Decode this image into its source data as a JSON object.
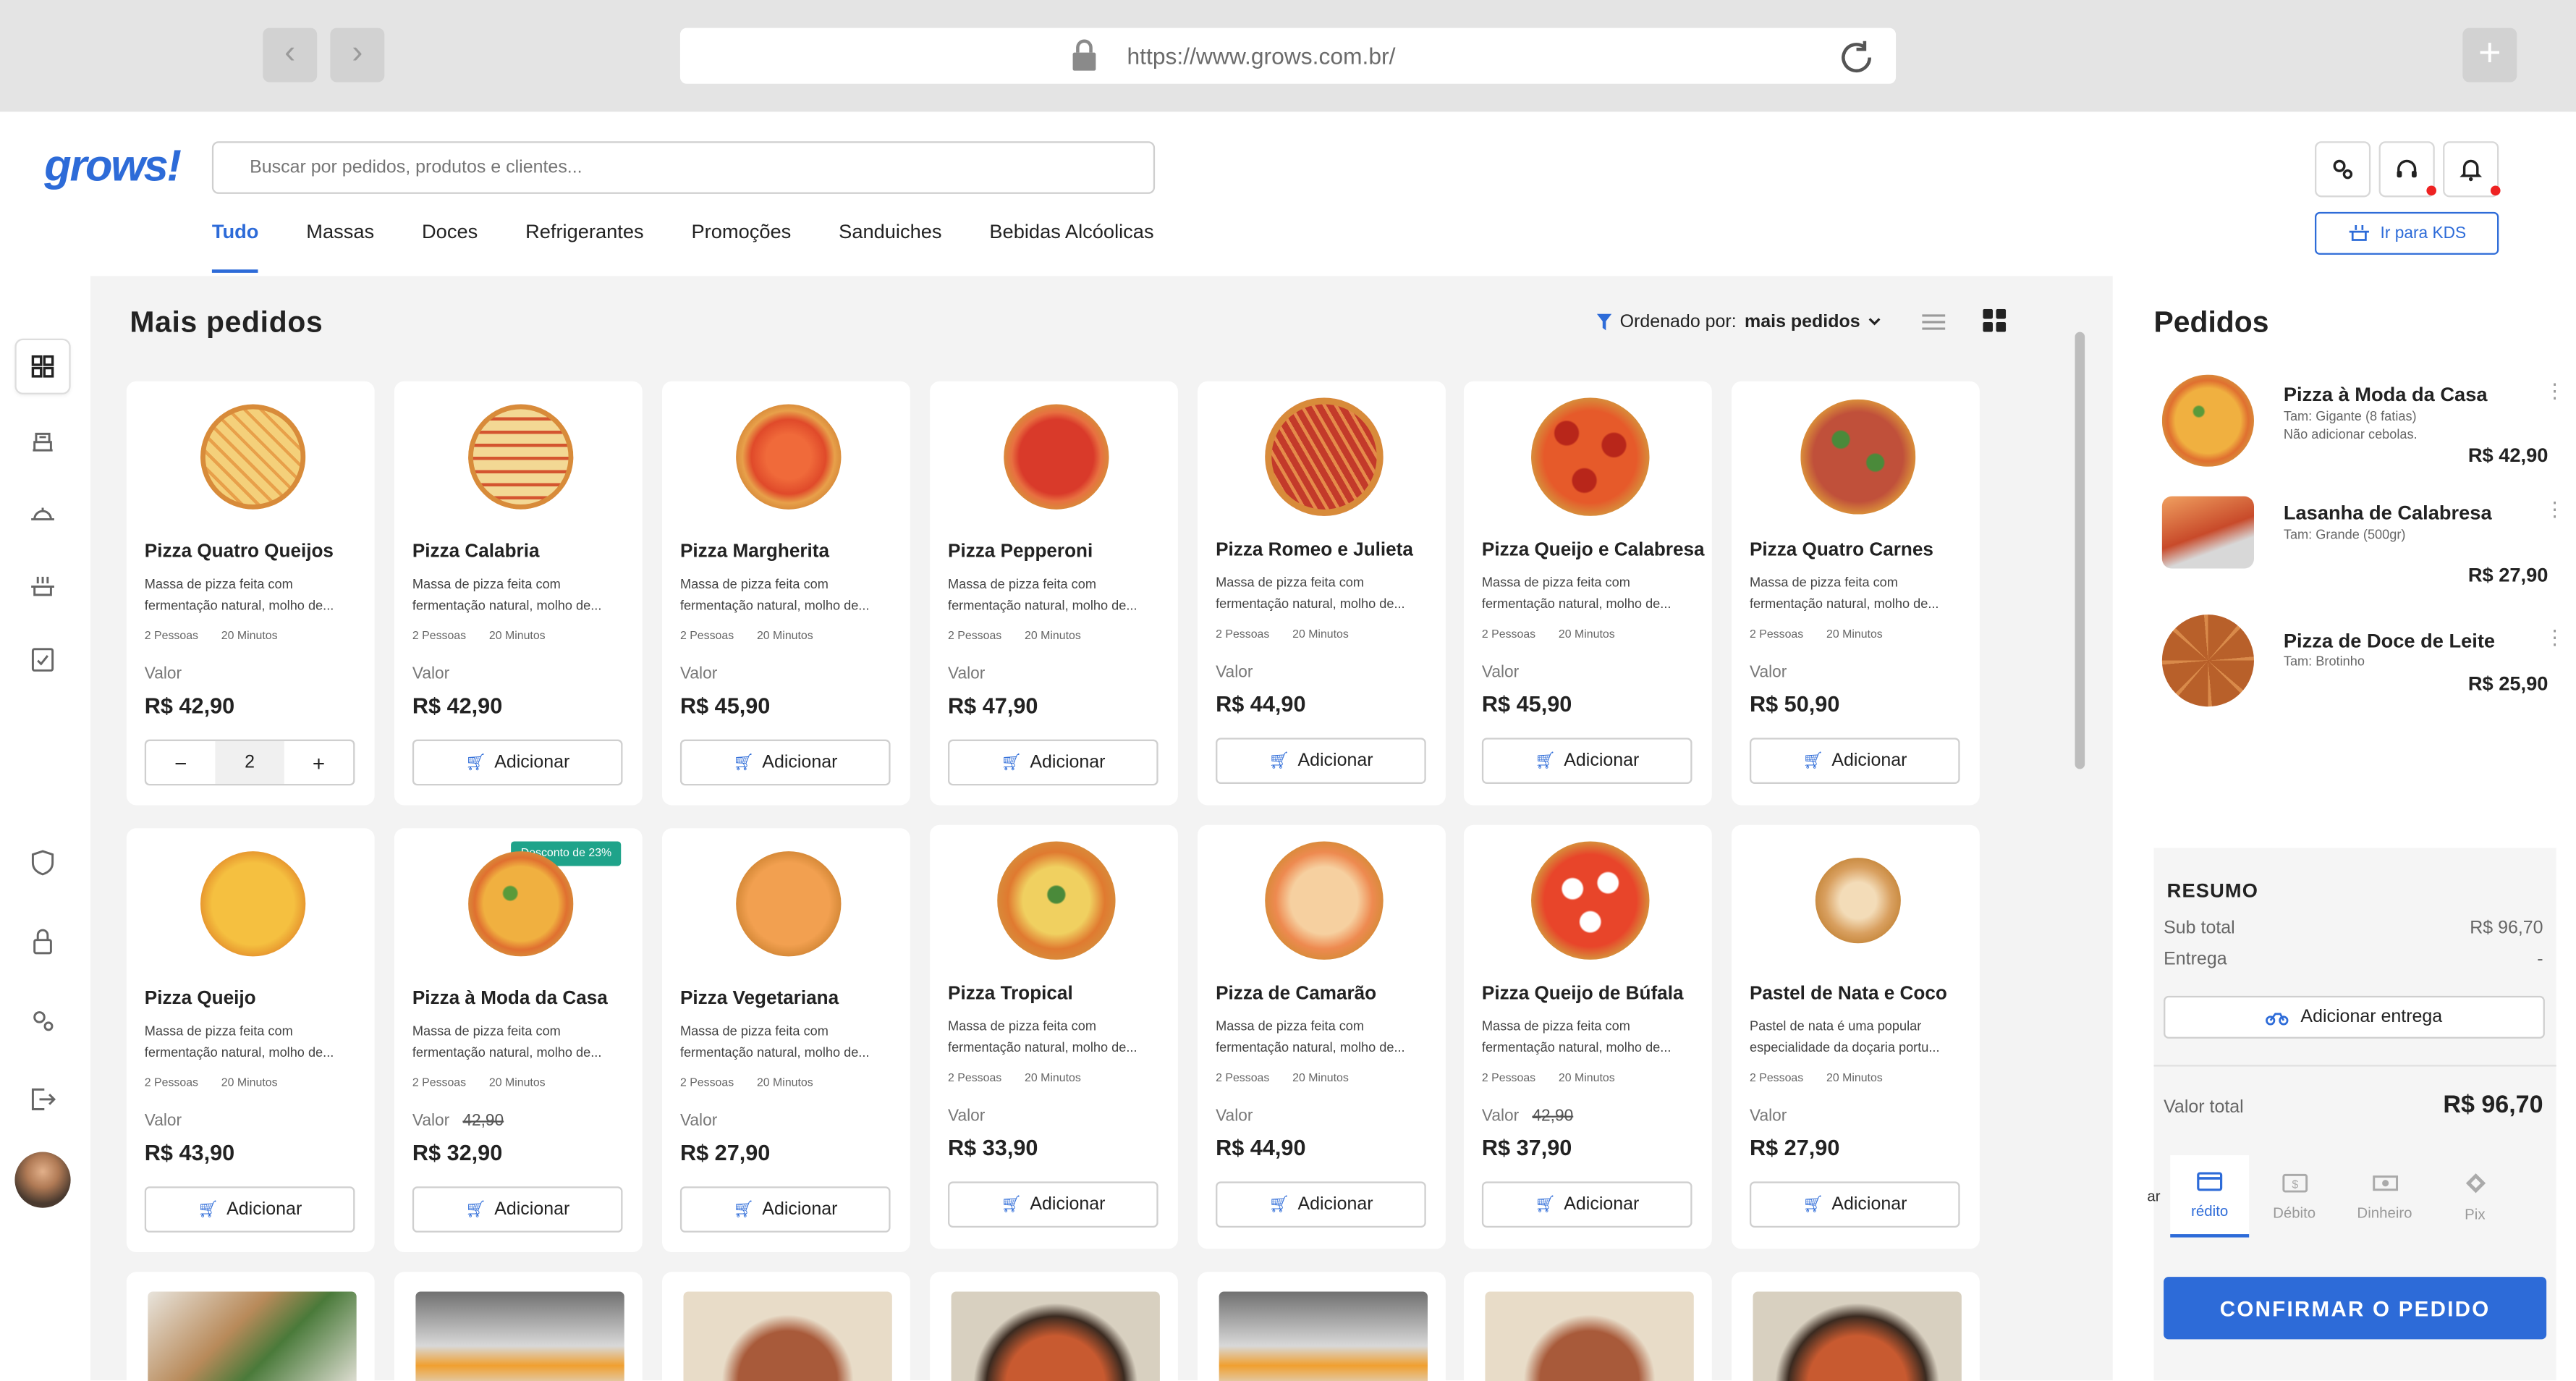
{
  "browser": {
    "url": "https://www.grows.com.br/",
    "back": "‹",
    "forward": "›",
    "new_tab": "+"
  },
  "app": {
    "logo": "grows!",
    "search_placeholder": "Buscar por pedidos, produtos e clientes...",
    "kds_label": "Ir para KDS"
  },
  "tabs": [
    "Tudo",
    "Massas",
    "Doces",
    "Refrigerantes",
    "Promoções",
    "Sanduiches",
    "Bebidas Alcóolicas"
  ],
  "main": {
    "title": "Mais pedidos",
    "order_prefix": "Ordenado por:",
    "order_value": "mais pedidos"
  },
  "labels": {
    "valor": "Valor",
    "adicionar": "Adicionar",
    "pessoas": "2 Pessoas",
    "minutos": "20 Minutos",
    "qty": "2"
  },
  "products_row1": [
    {
      "name": "Pizza Quatro Queijos",
      "desc": "Massa de pizza feita com fermentação natural, molho de...",
      "price": "R$ 42,90"
    },
    {
      "name": "Pizza Calabria",
      "desc": "Massa de pizza feita com fermentação natural, molho de...",
      "price": "R$ 42,90"
    },
    {
      "name": "Pizza Margherita",
      "desc": "Massa de pizza feita com fermentação natural, molho de...",
      "price": "R$ 45,90"
    },
    {
      "name": "Pizza Pepperoni",
      "desc": "Massa de pizza feita com fermentação natural, molho de...",
      "price": "R$ 47,90"
    },
    {
      "name": "Pizza Romeo e Julieta",
      "desc": "Massa de pizza feita com fermentação natural, molho de...",
      "price": "R$ 44,90"
    },
    {
      "name": "Pizza Queijo e Calabresa",
      "desc": "Massa de pizza feita com fermentação natural, molho de...",
      "price": "R$ 45,90"
    },
    {
      "name": "Pizza Quatro Carnes",
      "desc": "Massa de pizza feita com fermentação natural, molho de...",
      "price": "R$ 50,90"
    }
  ],
  "products_row2": [
    {
      "name": "Pizza Queijo",
      "desc": "Massa de pizza feita com fermentação natural, molho de...",
      "price": "R$ 43,90"
    },
    {
      "name": "Pizza à Moda da Casa",
      "desc": "Massa de pizza feita com fermentação natural, molho de...",
      "price": "R$ 32,90",
      "old": "42,90",
      "badge": "Desconto de 23%"
    },
    {
      "name": "Pizza Vegetariana",
      "desc": "Massa de pizza feita com fermentação natural, molho de...",
      "price": "R$ 27,90"
    },
    {
      "name": "Pizza Tropical",
      "desc": "Massa de pizza feita com fermentação natural, molho de...",
      "price": "R$ 33,90"
    },
    {
      "name": "Pizza de Camarão",
      "desc": "Massa de pizza feita com fermentação natural, molho de...",
      "price": "R$ 44,90"
    },
    {
      "name": "Pizza Queijo de Búfala",
      "desc": "Massa de pizza feita com fermentação natural, molho de...",
      "price": "R$ 37,90",
      "old": "42,90"
    },
    {
      "name": "Pastel de Nata e Coco",
      "desc": "Pastel de nata é uma popular especialidade da doçaria portu...",
      "price": "R$ 27,90"
    }
  ],
  "orders": {
    "title": "Pedidos",
    "items": [
      {
        "name": "Pizza à Moda da Casa",
        "sub1": "Tam: Gigante (8 fatias)",
        "sub2": "Não adicionar cebolas.",
        "price": "R$ 42,90"
      },
      {
        "name": "Lasanha de Calabresa",
        "sub1": "Tam: Grande (500gr)",
        "price": "R$ 27,90"
      },
      {
        "name": "Pizza de Doce de Leite",
        "sub1": "Tam: Brotinho",
        "price": "R$ 25,90"
      }
    ]
  },
  "summary": {
    "title": "RESUMO",
    "subtotal_label": "Sub total",
    "subtotal": "R$ 96,70",
    "entrega_label": "Entrega",
    "entrega": "-",
    "add_entrega": "Adicionar entrega",
    "total_label": "Valor total",
    "total": "R$ 96,70",
    "pay_cut": "ar",
    "payments": [
      "rédito",
      "Débito",
      "Dinheiro",
      "Pix"
    ],
    "confirm": "CONFIRMAR O PEDIDO"
  }
}
